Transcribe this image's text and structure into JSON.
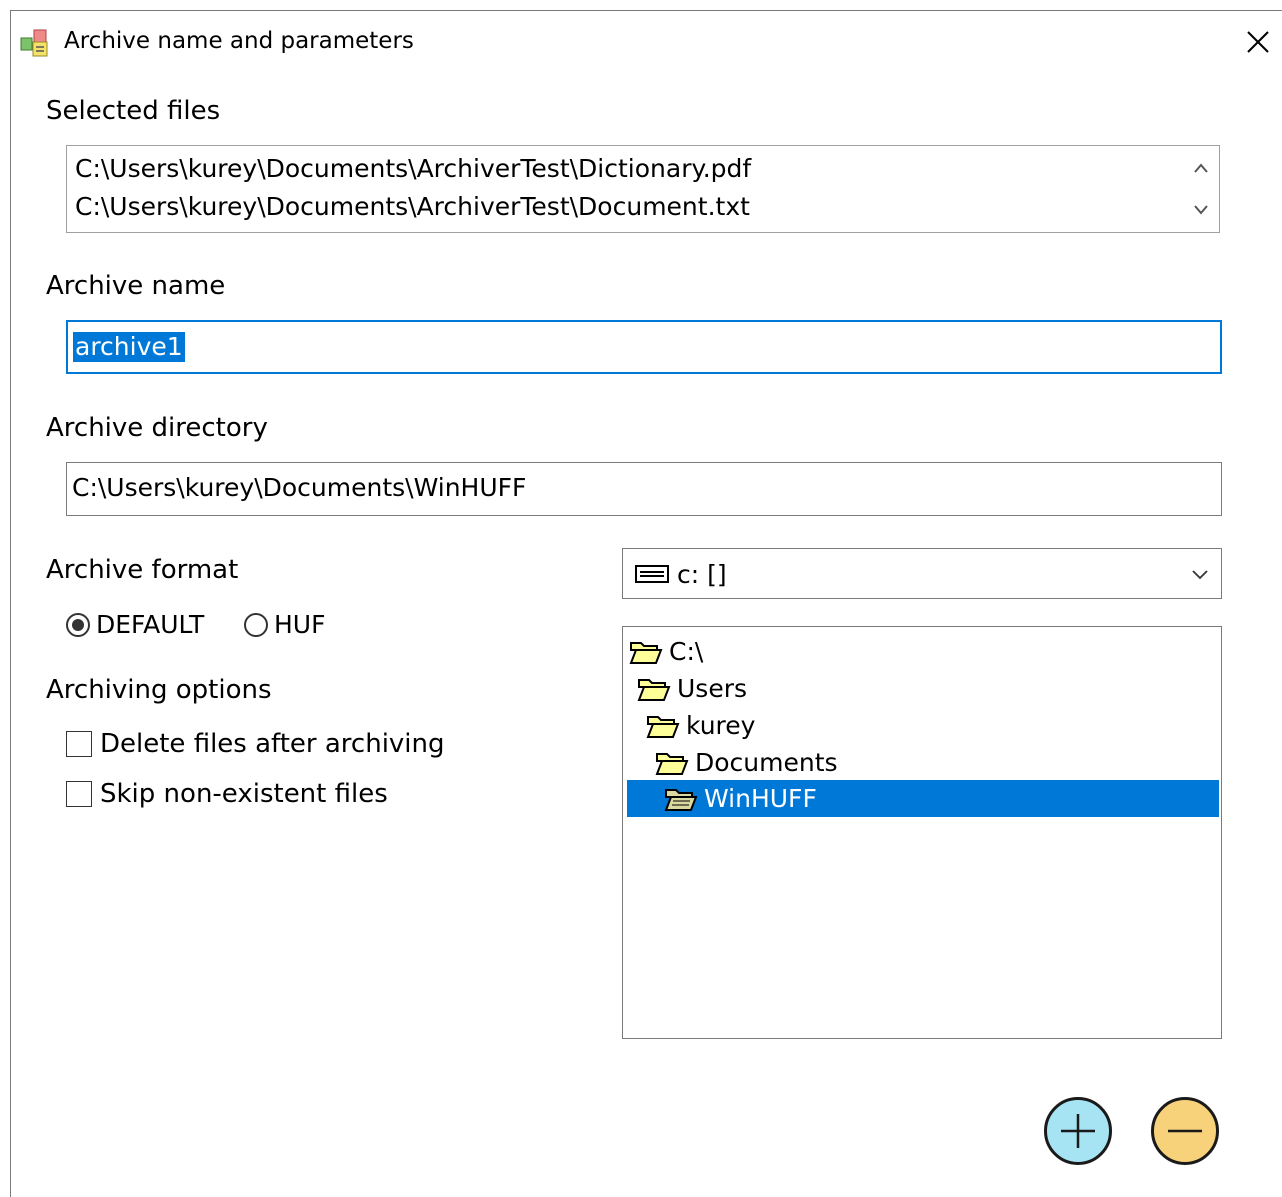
{
  "window": {
    "title": "Archive name and parameters"
  },
  "selected_files": {
    "label": "Selected files",
    "items": [
      "C:\\Users\\kurey\\Documents\\ArchiverTest\\Dictionary.pdf",
      "C:\\Users\\kurey\\Documents\\ArchiverTest\\Document.txt"
    ]
  },
  "archive_name": {
    "label": "Archive name",
    "value": "archive1"
  },
  "archive_directory": {
    "label": "Archive directory",
    "value": "C:\\Users\\kurey\\Documents\\WinHUFF"
  },
  "archive_format": {
    "label": "Archive format",
    "options": [
      "DEFAULT",
      "HUF"
    ],
    "selected": "DEFAULT"
  },
  "archiving_options": {
    "label": "Archiving options",
    "delete_files": {
      "label": "Delete files after archiving",
      "checked": false
    },
    "skip_nonexistent": {
      "label": "Skip non-existent files",
      "checked": false
    }
  },
  "drive": {
    "value": "c: []",
    "icon": "drive-icon"
  },
  "folder_tree": {
    "items": [
      "C:\\",
      "Users",
      "kurey",
      "Documents",
      "WinHUFF"
    ],
    "selected": "WinHUFF"
  },
  "buttons": {
    "add_icon": "plus-icon",
    "remove_icon": "minus-icon"
  },
  "colors": {
    "accent": "#0078d7",
    "add_button": "#a6e3f3",
    "remove_button": "#f7d27a",
    "folder": "#ffff99"
  }
}
